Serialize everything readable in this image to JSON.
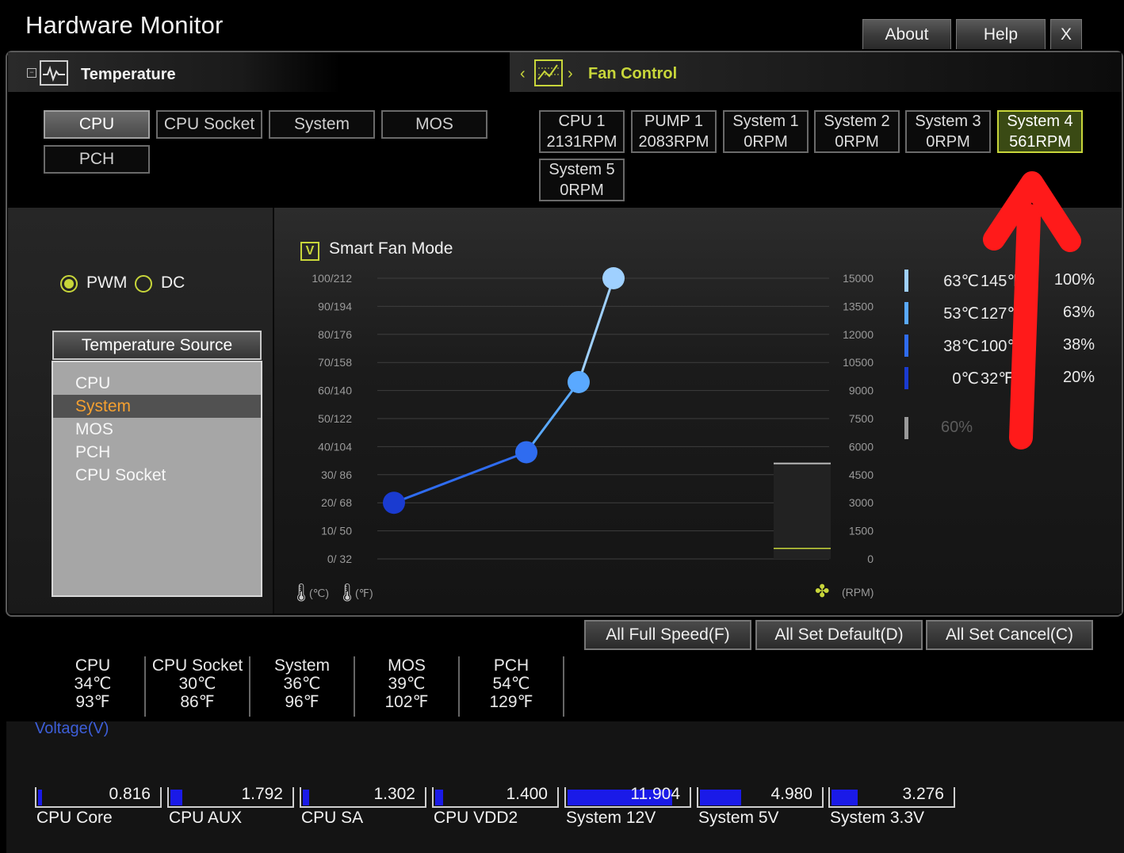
{
  "app": {
    "title": "Hardware Monitor",
    "top_buttons": [
      "About",
      "Help",
      "X"
    ]
  },
  "temperature_section": {
    "title": "Temperature",
    "tabs": [
      "CPU",
      "CPU Socket",
      "System",
      "MOS",
      "PCH"
    ],
    "active_tab": "CPU"
  },
  "fan_section": {
    "title": "Fan Control",
    "fans": [
      {
        "name": "CPU 1",
        "rpm": "2131RPM"
      },
      {
        "name": "PUMP 1",
        "rpm": "2083RPM"
      },
      {
        "name": "System 1",
        "rpm": "0RPM"
      },
      {
        "name": "System 2",
        "rpm": "0RPM"
      },
      {
        "name": "System 3",
        "rpm": "0RPM"
      },
      {
        "name": "System 4",
        "rpm": "561RPM"
      },
      {
        "name": "System 5",
        "rpm": "0RPM"
      }
    ],
    "active_fan": "System 4"
  },
  "mode": {
    "pwm_label": "PWM",
    "dc_label": "DC",
    "selected": "PWM"
  },
  "temperature_source": {
    "title": "Temperature Source",
    "items": [
      "CPU",
      "System",
      "MOS",
      "PCH",
      "CPU Socket"
    ],
    "selected": "System"
  },
  "smart_fan": {
    "label": "Smart Fan Mode",
    "checked": true,
    "check_mark": "V"
  },
  "chart_data": {
    "type": "line",
    "left_ticks": [
      "100/212",
      "90/194",
      "80/176",
      "70/158",
      "60/140",
      "50/122",
      "40/104",
      "30/ 86",
      "20/ 68",
      "10/ 50",
      "0/ 32"
    ],
    "right_ticks": [
      "15000",
      "13500",
      "12000",
      "10500",
      "9000",
      "7500",
      "6000",
      "4500",
      "3000",
      "1500",
      "0"
    ],
    "x_units": [
      "(℃)",
      "(℉)"
    ],
    "rpm_unit": "(RPM)",
    "points": [
      {
        "temp_c": 0,
        "pct": 20
      },
      {
        "temp_c": 38,
        "pct": 38
      },
      {
        "temp_c": 53,
        "pct": 63
      },
      {
        "temp_c": 63,
        "pct": 100
      }
    ],
    "current_rpm": 561,
    "rpm_max": 15000
  },
  "legend": [
    {
      "c": "63℃",
      "f": "145℉",
      "pct": "100%",
      "color": "#9fd0ff"
    },
    {
      "c": "53℃",
      "f": "127℉",
      "pct": "63%",
      "color": "#5aa9ff"
    },
    {
      "c": "38℃",
      "f": "100℉",
      "pct": "38%",
      "color": "#2f6cf0"
    },
    {
      "c": "0℃",
      "f": "32℉",
      "pct": "20%",
      "color": "#1a3bd0"
    }
  ],
  "legend_extra": {
    "value": "60%"
  },
  "bottom_buttons": [
    "All Full Speed(F)",
    "All Set Default(D)",
    "All Set Cancel(C)"
  ],
  "temperatures": [
    {
      "name": "CPU",
      "c": "34℃",
      "f": "93℉"
    },
    {
      "name": "CPU Socket",
      "c": "30℃",
      "f": "86℉"
    },
    {
      "name": "System",
      "c": "36℃",
      "f": "96℉"
    },
    {
      "name": "MOS",
      "c": "39℃",
      "f": "102℉"
    },
    {
      "name": "PCH",
      "c": "54℃",
      "f": "129℉"
    }
  ],
  "voltage": {
    "title": "Voltage(V)",
    "items": [
      {
        "name": "CPU Core",
        "value": "0.816",
        "level": 0.03
      },
      {
        "name": "CPU AUX",
        "value": "1.792",
        "level": 0.11
      },
      {
        "name": "CPU SA",
        "value": "1.302",
        "level": 0.06
      },
      {
        "name": "CPU VDD2",
        "value": "1.400",
        "level": 0.07
      },
      {
        "name": "System 12V",
        "value": "11.904",
        "level": 0.97
      },
      {
        "name": "System 5V",
        "value": "4.980",
        "level": 0.38
      },
      {
        "name": "System 3.3V",
        "value": "3.276",
        "level": 0.24
      }
    ]
  },
  "colors": {
    "accent": "#c8d63a",
    "voltage_bar": "#1a1ae8",
    "selected_source": "#f5a030",
    "annotation_arrow": "#ff1a1a"
  }
}
